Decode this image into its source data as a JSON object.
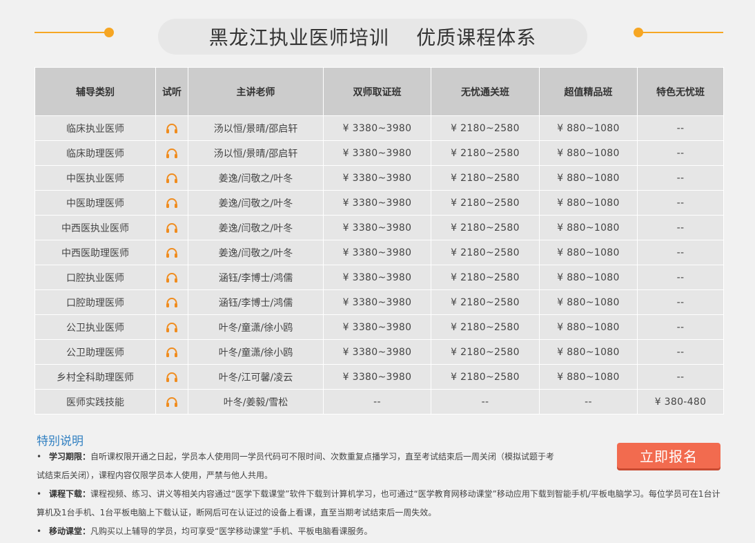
{
  "header": {
    "title": "黑龙江执业医师培训    优质课程体系"
  },
  "colors": {
    "accent": "#f6a623",
    "button": "#f26b4f",
    "note_title": "#2f7fc1",
    "header_cell": "#cccccc",
    "body_cell": "#e6e6e6"
  },
  "table": {
    "headers": [
      "辅导类别",
      "试听",
      "主讲老师",
      "双师取证班",
      "无忧通关班",
      "超值精品班",
      "特色无忧班"
    ],
    "listen_icon": "headphones-icon",
    "rows": [
      {
        "category": "临床执业医师",
        "teachers": "汤以恒/景晴/邵启轩",
        "p1": "¥ 3380~3980",
        "p2": "¥ 2180~2580",
        "p3": "¥ 880~1080",
        "p4": "--"
      },
      {
        "category": "临床助理医师",
        "teachers": "汤以恒/景晴/邵启轩",
        "p1": "¥ 3380~3980",
        "p2": "¥ 2180~2580",
        "p3": "¥ 880~1080",
        "p4": "--"
      },
      {
        "category": "中医执业医师",
        "teachers": "姜逸/闫敬之/叶冬",
        "p1": "¥ 3380~3980",
        "p2": "¥ 2180~2580",
        "p3": "¥ 880~1080",
        "p4": "--"
      },
      {
        "category": "中医助理医师",
        "teachers": "姜逸/闫敬之/叶冬",
        "p1": "¥ 3380~3980",
        "p2": "¥ 2180~2580",
        "p3": "¥ 880~1080",
        "p4": "--"
      },
      {
        "category": "中西医执业医师",
        "teachers": "姜逸/闫敬之/叶冬",
        "p1": "¥ 3380~3980",
        "p2": "¥ 2180~2580",
        "p3": "¥ 880~1080",
        "p4": "--"
      },
      {
        "category": "中西医助理医师",
        "teachers": "姜逸/闫敬之/叶冬",
        "p1": "¥ 3380~3980",
        "p2": "¥ 2180~2580",
        "p3": "¥ 880~1080",
        "p4": "--"
      },
      {
        "category": "口腔执业医师",
        "teachers": "涵钰/李博士/鸿儒",
        "p1": "¥ 3380~3980",
        "p2": "¥ 2180~2580",
        "p3": "¥ 880~1080",
        "p4": "--"
      },
      {
        "category": "口腔助理医师",
        "teachers": "涵钰/李博士/鸿儒",
        "p1": "¥ 3380~3980",
        "p2": "¥ 2180~2580",
        "p3": "¥ 880~1080",
        "p4": "--"
      },
      {
        "category": "公卫执业医师",
        "teachers": "叶冬/童潇/徐小鸥",
        "p1": "¥ 3380~3980",
        "p2": "¥ 2180~2580",
        "p3": "¥ 880~1080",
        "p4": "--"
      },
      {
        "category": "公卫助理医师",
        "teachers": "叶冬/童潇/徐小鸥",
        "p1": "¥ 3380~3980",
        "p2": "¥ 2180~2580",
        "p3": "¥ 880~1080",
        "p4": "--"
      },
      {
        "category": "乡村全科助理医师",
        "teachers": "叶冬/江可馨/凌云",
        "p1": "¥ 3380~3980",
        "p2": "¥ 2180~2580",
        "p3": "¥ 880~1080",
        "p4": "--"
      },
      {
        "category": "医师实践技能",
        "teachers": "叶冬/姜毅/雪松",
        "p1": "--",
        "p2": "--",
        "p3": "--",
        "p4": "¥ 380-480"
      }
    ]
  },
  "notes": {
    "title": "特别说明",
    "bullet": "•",
    "items": [
      {
        "label": "学习期限：",
        "text": "自听课权限开通之日起，学员本人使用同一学员代码可不限时间、次数重复点播学习，直至考试结束后一周关闭（模拟试题于考试结束后关闭），课程内容仅限学员本人使用，严禁与他人共用。"
      },
      {
        "label": "课程下载：",
        "text": "课程视频、练习、讲义等相关内容通过“医学下载课堂”软件下载到计算机学习，也可通过“医学教育网移动课堂”移动应用下载到智能手机/平板电脑学习。每位学员可在1台计算机及1台手机、1台平板电脑上下载认证，断网后可在认证过的设备上看课，直至当期考试结束后一周失效。"
      },
      {
        "label": "移动课堂：",
        "text": "凡购买以上辅导的学员，均可享受“医学移动课堂”手机、平板电脑看课服务。"
      }
    ]
  },
  "signup_button": {
    "label": "立即报名"
  }
}
